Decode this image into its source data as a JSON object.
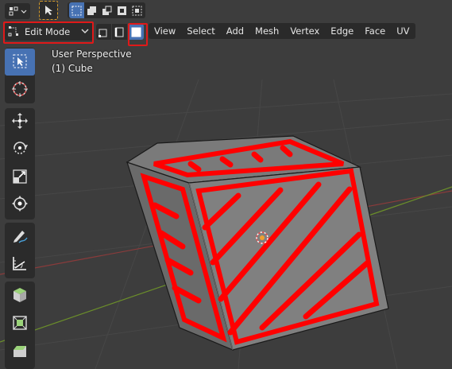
{
  "header": {
    "mode_label": "Edit Mode",
    "menus": [
      "View",
      "Select",
      "Add",
      "Mesh",
      "Vertex",
      "Edge",
      "Face",
      "UV"
    ]
  },
  "viewport": {
    "perspective_label": "User Perspective",
    "object_label": "(1) Cube"
  },
  "colors": {
    "background": "#3d3d3d",
    "panel": "#2b2b2b",
    "accent": "#4772b3",
    "highlight": "#e01919",
    "face": "#7b7b7b",
    "grid_green": "#6b8e2a",
    "grid_red": "#8a3b3b"
  },
  "icons": {
    "editor_type": "cube-editor-icon",
    "select_tool": "cursor-arrow-icon",
    "select_modes": [
      "select-new-icon",
      "select-extend-icon",
      "select-subtract-icon",
      "select-invert-icon",
      "select-intersect-icon"
    ],
    "mesh_select": [
      "vertex-select-icon",
      "edge-select-icon",
      "face-select-icon"
    ],
    "tools": [
      "select-box-icon",
      "cursor-icon",
      "move-icon",
      "rotate-icon",
      "scale-icon",
      "transform-icon",
      "annotate-icon",
      "measure-icon",
      "add-cube-icon",
      "extrude-icon",
      "inset-icon",
      "bevel-icon"
    ]
  }
}
